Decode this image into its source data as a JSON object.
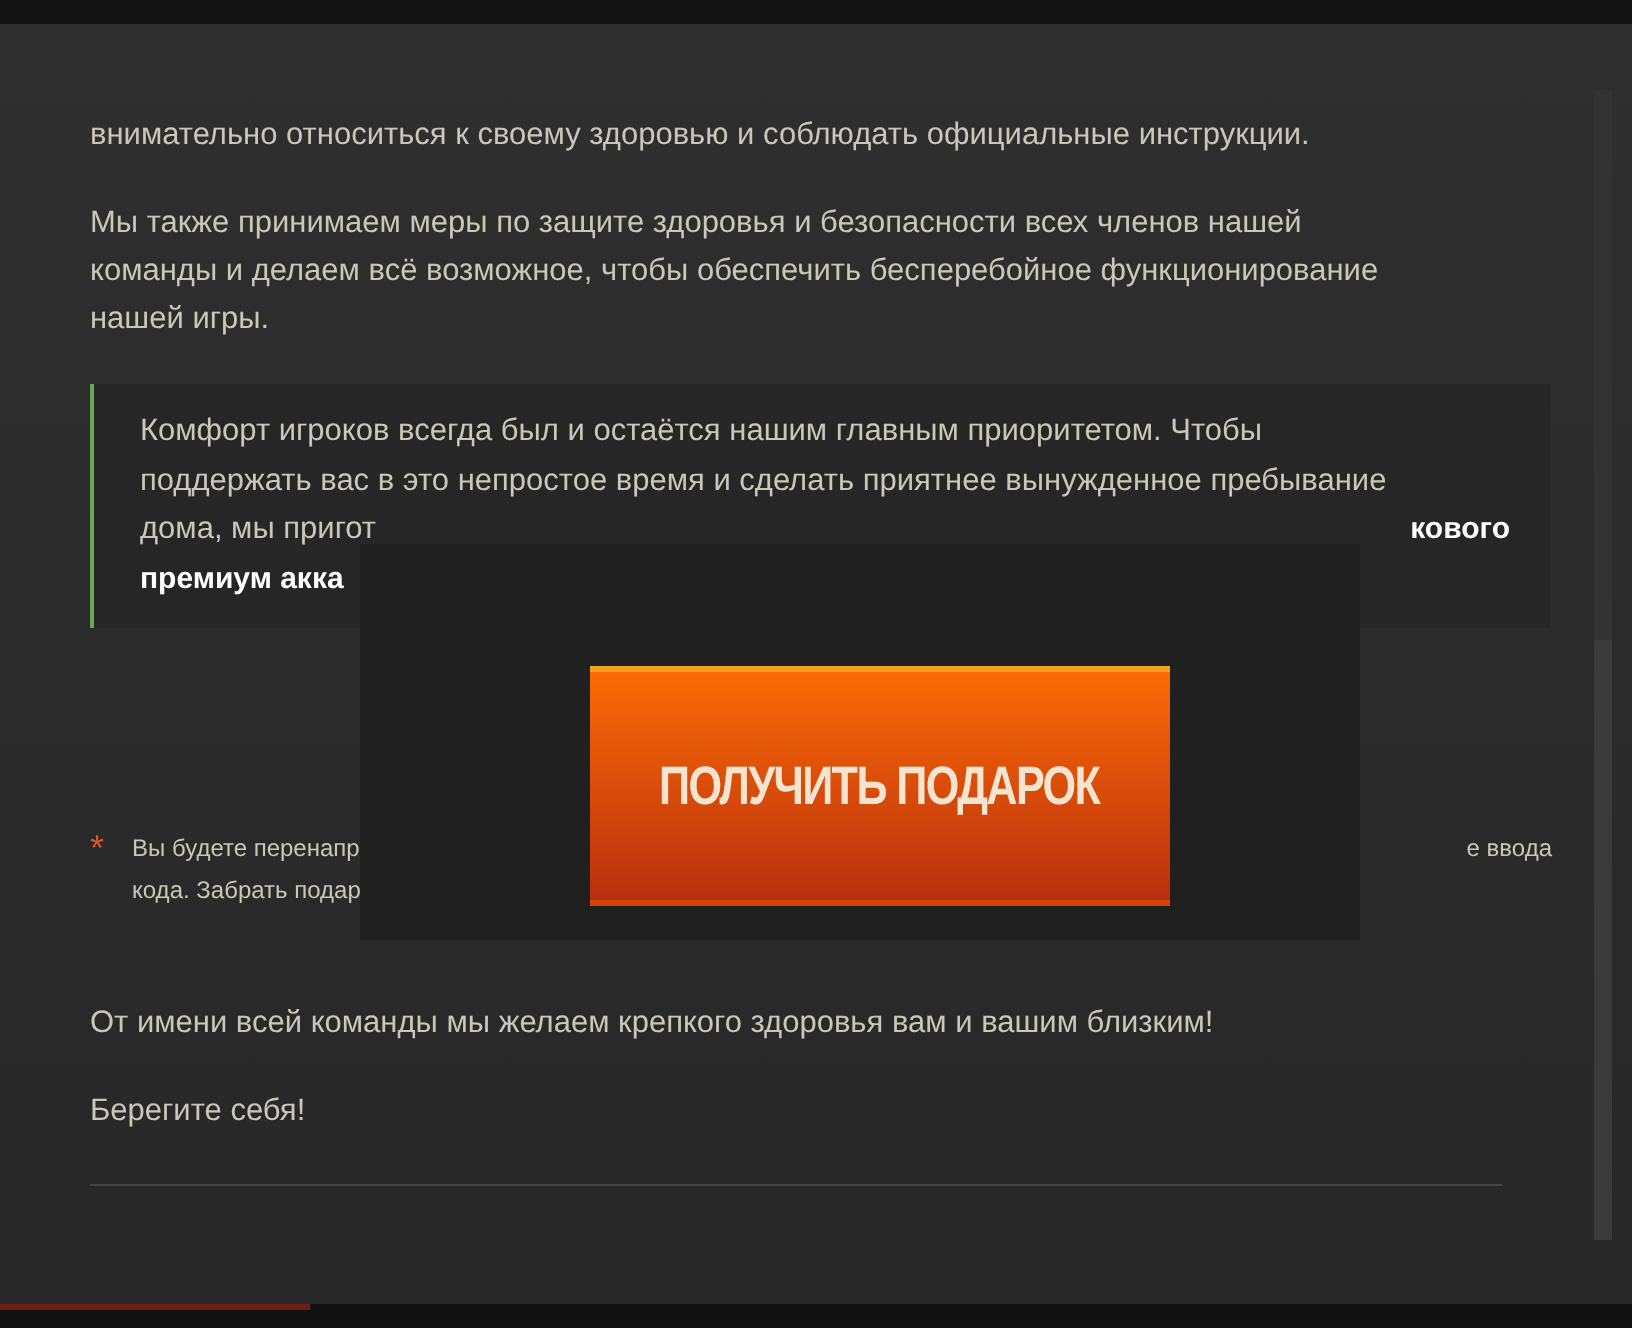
{
  "intro": [
    [
      "внимательно относиться к своему здоровью и соблюдать официальные инструкции."
    ],
    [
      "Мы также принимаем меры по защите здоровья и безопасности всех членов нашей",
      "команды и делаем всё возможное, чтобы обеспечить бесперебойное функционирование",
      "нашей игры."
    ]
  ],
  "quote": {
    "lines": [
      "Комфорт игроков всегда был и остаётся нашим главным приоритетом. Чтобы",
      "поддержать вас в это непростое время и сделать приятнее вынужденное пребывание"
    ],
    "visible_left": "дома, мы пригот",
    "visible_right": "кового",
    "visible_bold": "премиум акка"
  },
  "gift_button": {
    "label": "ПОЛУЧИТЬ ПОДАРОК"
  },
  "footnote": {
    "mark": "*",
    "line1_left": "Вы будете перенапр",
    "line1_right": "е ввода",
    "line2": "кода. Забрать подар"
  },
  "closing": [
    "От имени всей команды мы желаем крепкого здоровья вам и вашим близким!",
    "Берегите себя!"
  ]
}
